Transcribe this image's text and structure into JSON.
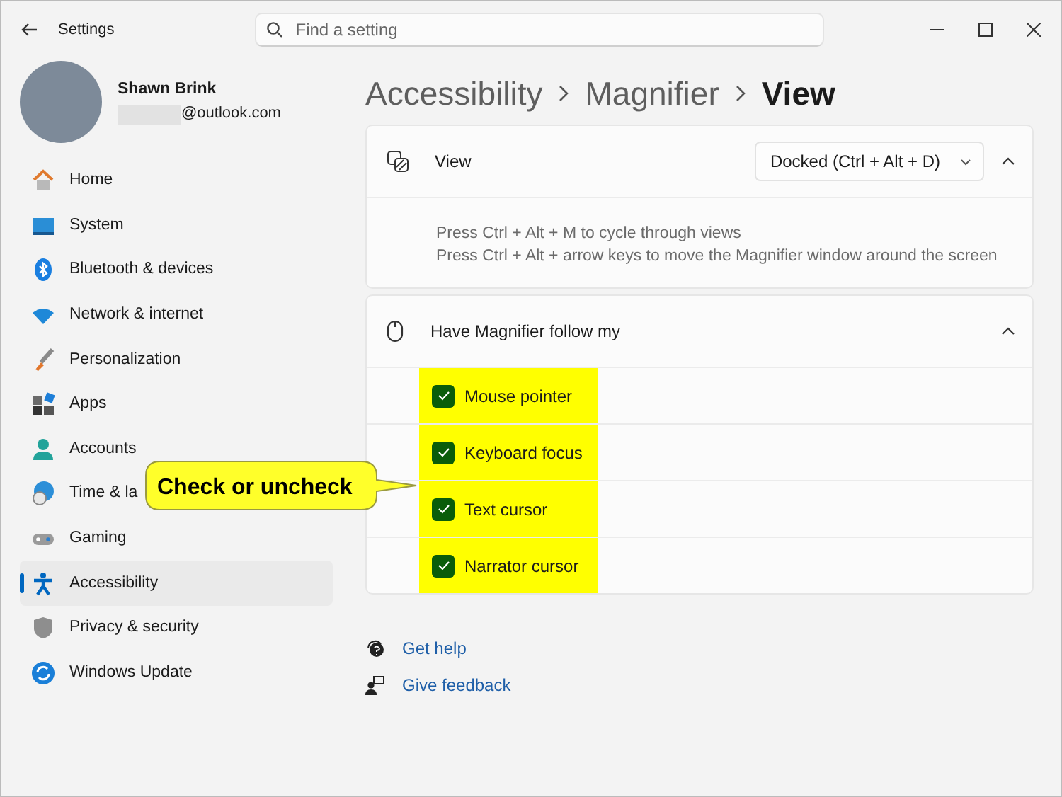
{
  "window": {
    "title": "Settings"
  },
  "search": {
    "placeholder": "Find a setting"
  },
  "profile": {
    "name": "Shawn Brink",
    "email": "@outlook.com"
  },
  "sidebar": {
    "items": [
      {
        "label": "Home",
        "selected": false
      },
      {
        "label": "System",
        "selected": false
      },
      {
        "label": "Bluetooth & devices",
        "selected": false
      },
      {
        "label": "Network & internet",
        "selected": false
      },
      {
        "label": "Personalization",
        "selected": false
      },
      {
        "label": "Apps",
        "selected": false
      },
      {
        "label": "Accounts",
        "selected": false
      },
      {
        "label": "Time & la",
        "selected": false
      },
      {
        "label": "Gaming",
        "selected": false
      },
      {
        "label": "Accessibility",
        "selected": true
      },
      {
        "label": "Privacy & security",
        "selected": false
      },
      {
        "label": "Windows Update",
        "selected": false
      }
    ]
  },
  "breadcrumb": [
    "Accessibility",
    "Magnifier",
    "View"
  ],
  "view_card": {
    "title": "View",
    "expanded": true,
    "dropdown": {
      "value": "Docked (Ctrl + Alt + D)"
    },
    "hints": [
      "Press Ctrl + Alt + M to cycle through views",
      "Press Ctrl + Alt + arrow keys to move the Magnifier window around the screen"
    ]
  },
  "follow_card": {
    "title": "Have Magnifier follow my",
    "expanded": true,
    "options": [
      {
        "label": "Mouse pointer",
        "checked": true
      },
      {
        "label": "Keyboard focus",
        "checked": true
      },
      {
        "label": "Text cursor",
        "checked": true
      },
      {
        "label": "Narrator cursor",
        "checked": true
      }
    ]
  },
  "links": [
    "Get help",
    "Give feedback"
  ],
  "annotation": {
    "text": "Check or uncheck"
  }
}
